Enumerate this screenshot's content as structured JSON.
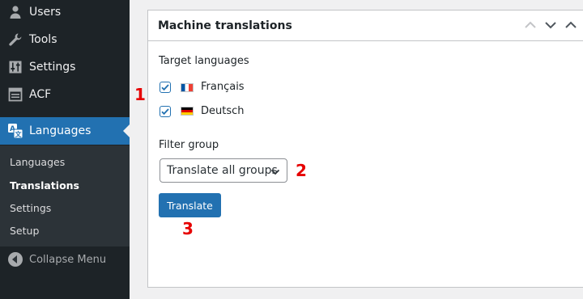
{
  "sidebar": {
    "items": [
      {
        "label": "Users",
        "icon": "users-icon"
      },
      {
        "label": "Tools",
        "icon": "wrench-icon"
      },
      {
        "label": "Settings",
        "icon": "settings-sliders-icon"
      },
      {
        "label": "ACF",
        "icon": "acf-icon"
      },
      {
        "label": "Languages",
        "icon": "translation-icon",
        "current": true
      }
    ],
    "submenu": [
      "Languages",
      "Translations",
      "Settings",
      "Setup"
    ],
    "active_submenu": "Translations",
    "collapse_label": "Collapse Menu"
  },
  "postbox": {
    "title": "Machine translations",
    "target_languages_label": "Target languages",
    "languages": [
      {
        "name": "Français",
        "flag": "flag-fr",
        "checked": true
      },
      {
        "name": "Deutsch",
        "flag": "flag-de",
        "checked": true
      }
    ],
    "filter_group_label": "Filter group",
    "filter_group_value": "Translate all groups",
    "translate_button": "Translate"
  },
  "annotations": [
    "1",
    "2",
    "3"
  ],
  "colors": {
    "sidebar_bg": "#1d2327",
    "submenu_bg": "#2c3338",
    "accent": "#2271b1",
    "annotation": "#e60000"
  }
}
